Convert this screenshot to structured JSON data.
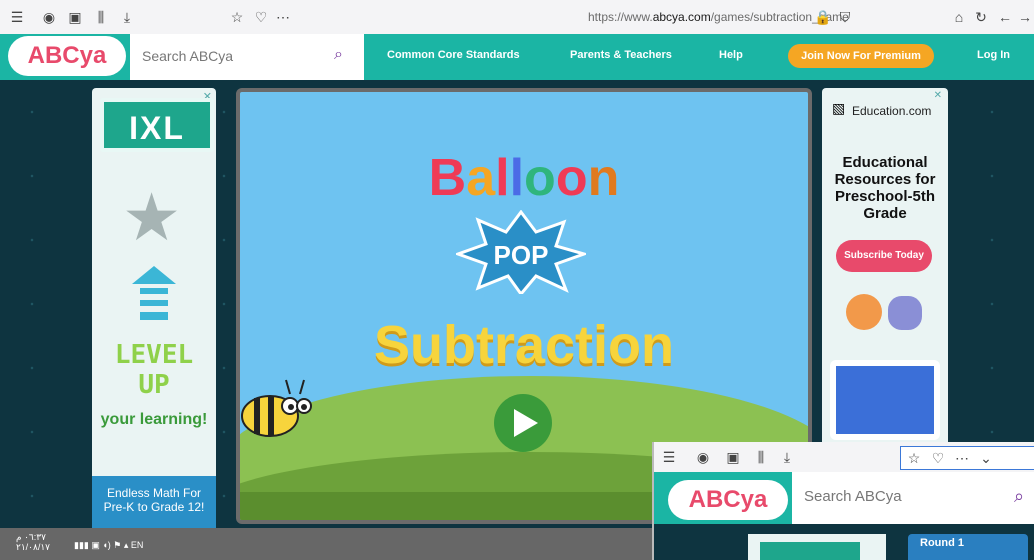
{
  "browser": {
    "url_prefix": "https://www.",
    "url_host": "abcya.com",
    "url_path": "/games/subtraction_game"
  },
  "site": {
    "logo_text": "ABCya",
    "search_placeholder": "Search ABCya",
    "nav": [
      "Common Core Standards",
      "Parents & Teachers",
      "Help"
    ],
    "join_label": "Join Now For Premium",
    "login_label": "Log In"
  },
  "ad_left": {
    "brand": "IXL",
    "level_up": "LEVEL UP",
    "tagline": "your learning!",
    "footer": "Endless Math For Pre-K to Grade 12!"
  },
  "game": {
    "title_line1": "Balloon",
    "title_line2": "POP",
    "title_line3": "Subtraction"
  },
  "ad_right": {
    "brand": "Education.com",
    "headline": "Educational Resources for Preschool-5th Grade",
    "cta": "Subscribe Today"
  },
  "taskbar": {
    "time": "٠٦:٣٧ م",
    "date": "٢١/٠٨/١٧",
    "lang": "EN"
  },
  "inner_window": {
    "logo_text": "ABCya",
    "search_placeholder": "Search ABCya",
    "round_label": "Round 1"
  }
}
